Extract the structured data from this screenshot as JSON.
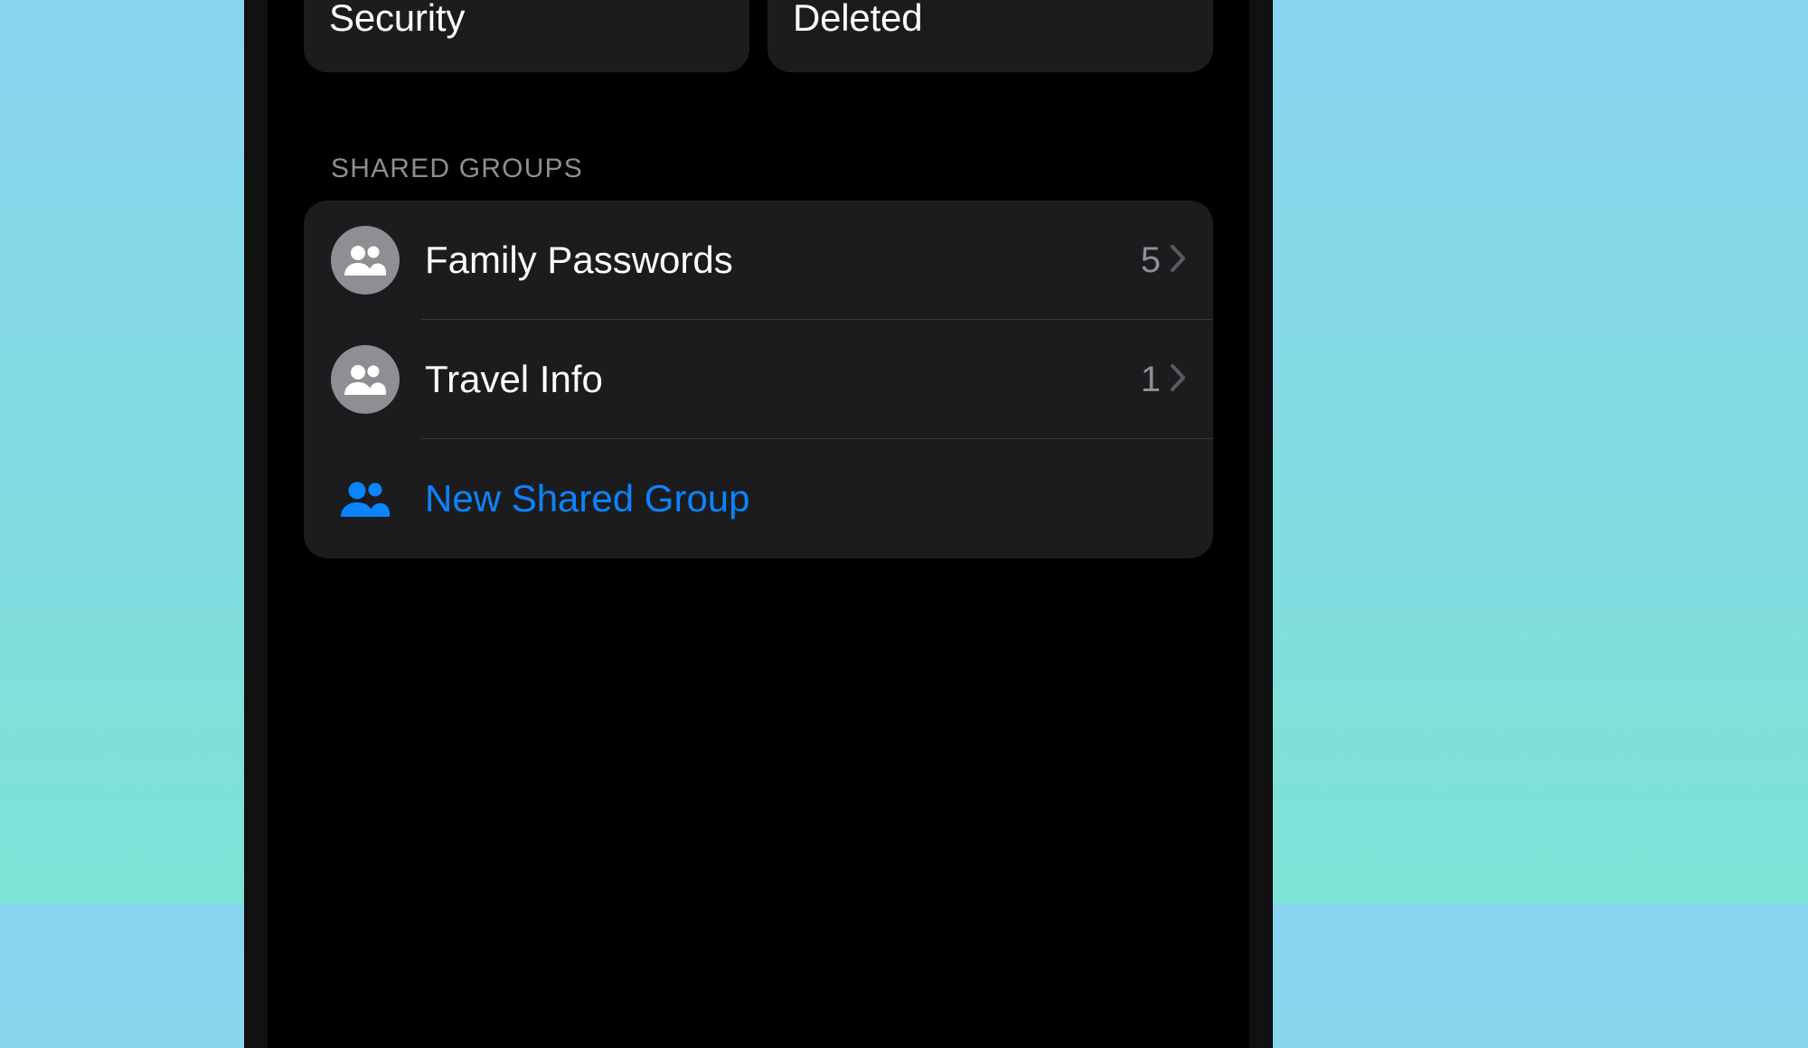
{
  "colors": {
    "accent": "#0a84ff",
    "tile_security_icon": "#ff3b30",
    "tile_deleted_icon": "#ff9500",
    "group_icon_bg": "#8e8e93"
  },
  "tiles": {
    "security": {
      "label": "Security"
    },
    "deleted": {
      "label": "Deleted"
    }
  },
  "shared_groups": {
    "header": "SHARED GROUPS",
    "items": [
      {
        "label": "Family Passwords",
        "count": "5"
      },
      {
        "label": "Travel Info",
        "count": "1"
      }
    ],
    "new_label": "New Shared Group"
  }
}
